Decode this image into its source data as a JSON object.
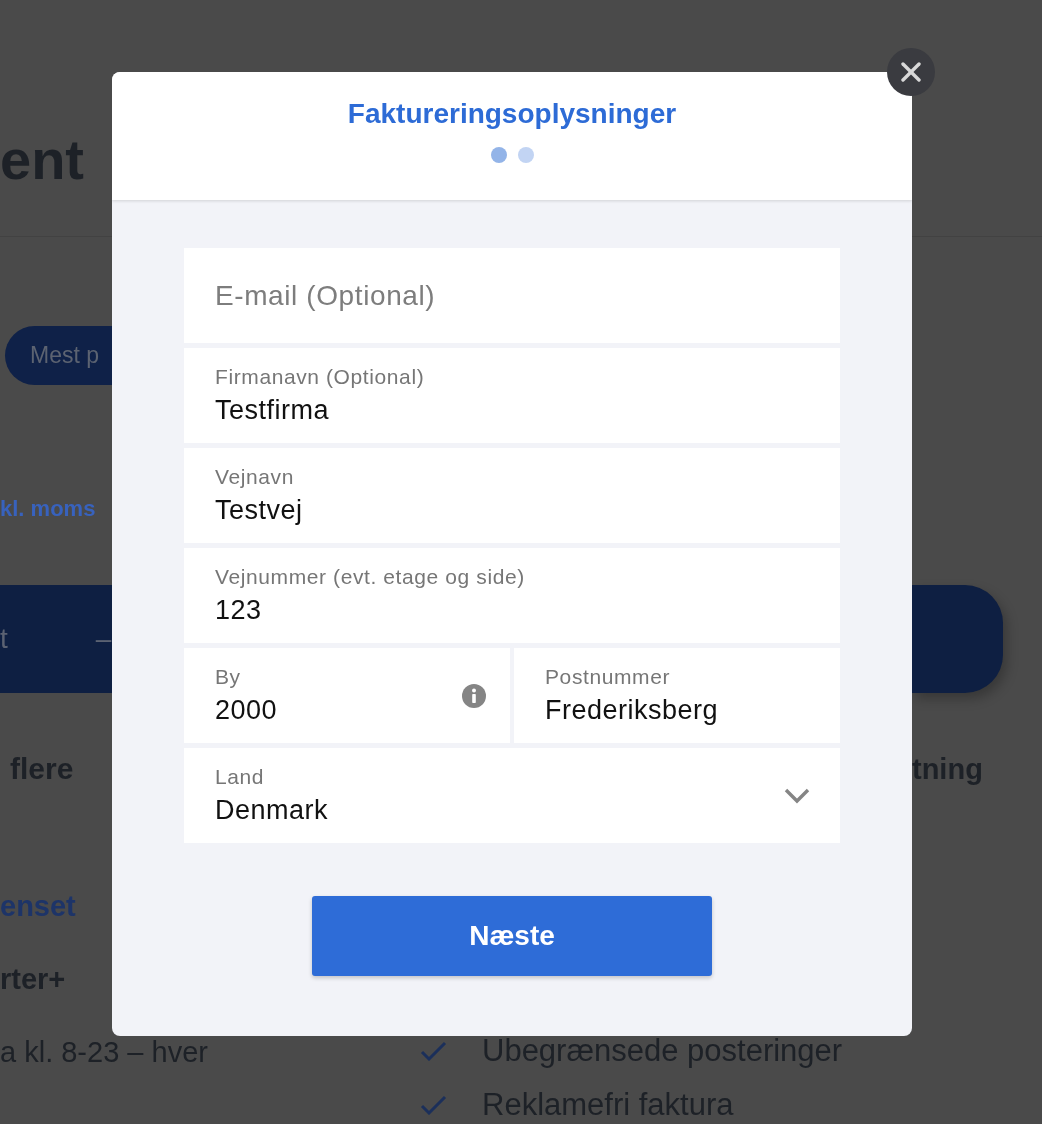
{
  "background": {
    "heading": "ent",
    "pill_button": "Mest p",
    "price_note": "kl. moms",
    "banner": {
      "label": "t",
      "separator": "–"
    },
    "more_text": "flere",
    "right_text": "tning",
    "link_text": "enset",
    "plan_name": "rter+",
    "support_text": "a kl. 8-23 – hver",
    "features": [
      "Ubegrænsede posteringer",
      "Reklamefri faktura"
    ]
  },
  "dialog": {
    "title": "Faktureringsoplysninger",
    "steps": [
      {
        "selected": true
      },
      {
        "selected": false
      }
    ],
    "rows": [
      {
        "fields": [
          {
            "kind": "text",
            "placeholder": "E-mail (Optional)"
          }
        ]
      },
      {
        "fields": [
          {
            "kind": "text",
            "label": "Firmanavn (Optional)",
            "value": "Testfirma"
          }
        ]
      },
      {
        "fields": [
          {
            "kind": "text",
            "label": "Vejnavn",
            "value": "Testvej"
          }
        ]
      },
      {
        "fields": [
          {
            "kind": "text",
            "label": "Vejnummer (evt. etage og side)",
            "value": "123"
          }
        ]
      },
      {
        "fields": [
          {
            "kind": "text",
            "label": "By",
            "value": "2000",
            "info": true
          },
          {
            "kind": "text",
            "label": "Postnummer",
            "value": "Frederiksberg"
          }
        ]
      },
      {
        "fields": [
          {
            "kind": "select",
            "label": "Land",
            "value": "Denmark"
          }
        ]
      }
    ],
    "next_button": "Næste"
  }
}
